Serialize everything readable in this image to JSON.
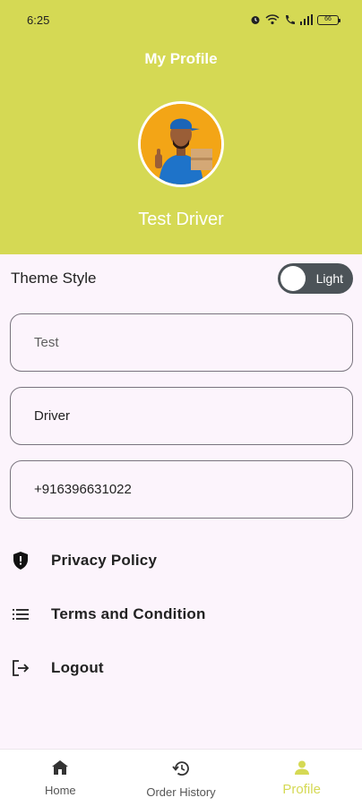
{
  "status_bar": {
    "time": "6:25",
    "battery": "66"
  },
  "header": {
    "title": "My Profile",
    "name": "Test Driver"
  },
  "theme": {
    "label": "Theme Style",
    "toggle_label": "Light"
  },
  "fields": [
    {
      "value": "Test"
    },
    {
      "value": "Driver"
    },
    {
      "value": "+916396631022"
    }
  ],
  "menu": [
    {
      "label": "Privacy Policy",
      "icon": "shield-icon"
    },
    {
      "label": "Terms and Condition",
      "icon": "list-icon"
    },
    {
      "label": "Logout",
      "icon": "logout-icon"
    }
  ],
  "nav": [
    {
      "label": "Home",
      "icon": "home-icon"
    },
    {
      "label": "Order History",
      "icon": "history-icon"
    },
    {
      "label": "Profile",
      "icon": "person-icon",
      "active": true
    }
  ],
  "colors": {
    "accent": "#d5d954",
    "background": "#fcf4fc",
    "toggle": "#4c5358"
  }
}
